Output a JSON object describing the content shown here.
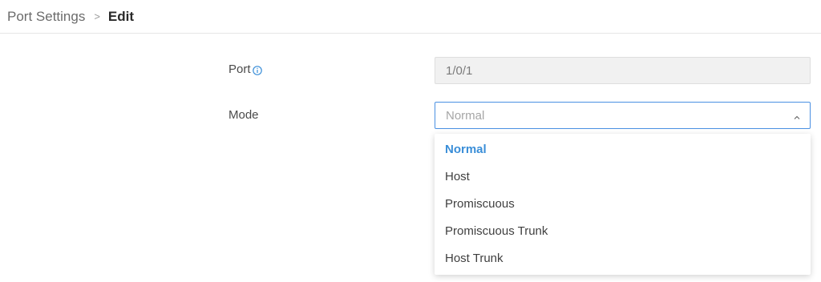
{
  "breadcrumb": {
    "parent": "Port Settings",
    "separator": ">",
    "current": "Edit"
  },
  "form": {
    "port": {
      "label": "Port",
      "value": "1/0/1",
      "info_icon": "info-circle-icon"
    },
    "mode": {
      "label": "Mode",
      "value": "Normal",
      "expanded": true,
      "chevron_icon": "chevron-up-icon",
      "options": [
        "Normal",
        "Host",
        "Promiscuous",
        "Promiscuous Trunk",
        "Host Trunk"
      ],
      "selected_index": 0
    }
  },
  "colors": {
    "accent": "#3a8ed8",
    "focus_border": "#4a90e2",
    "readonly_bg": "#f1f1f1"
  }
}
